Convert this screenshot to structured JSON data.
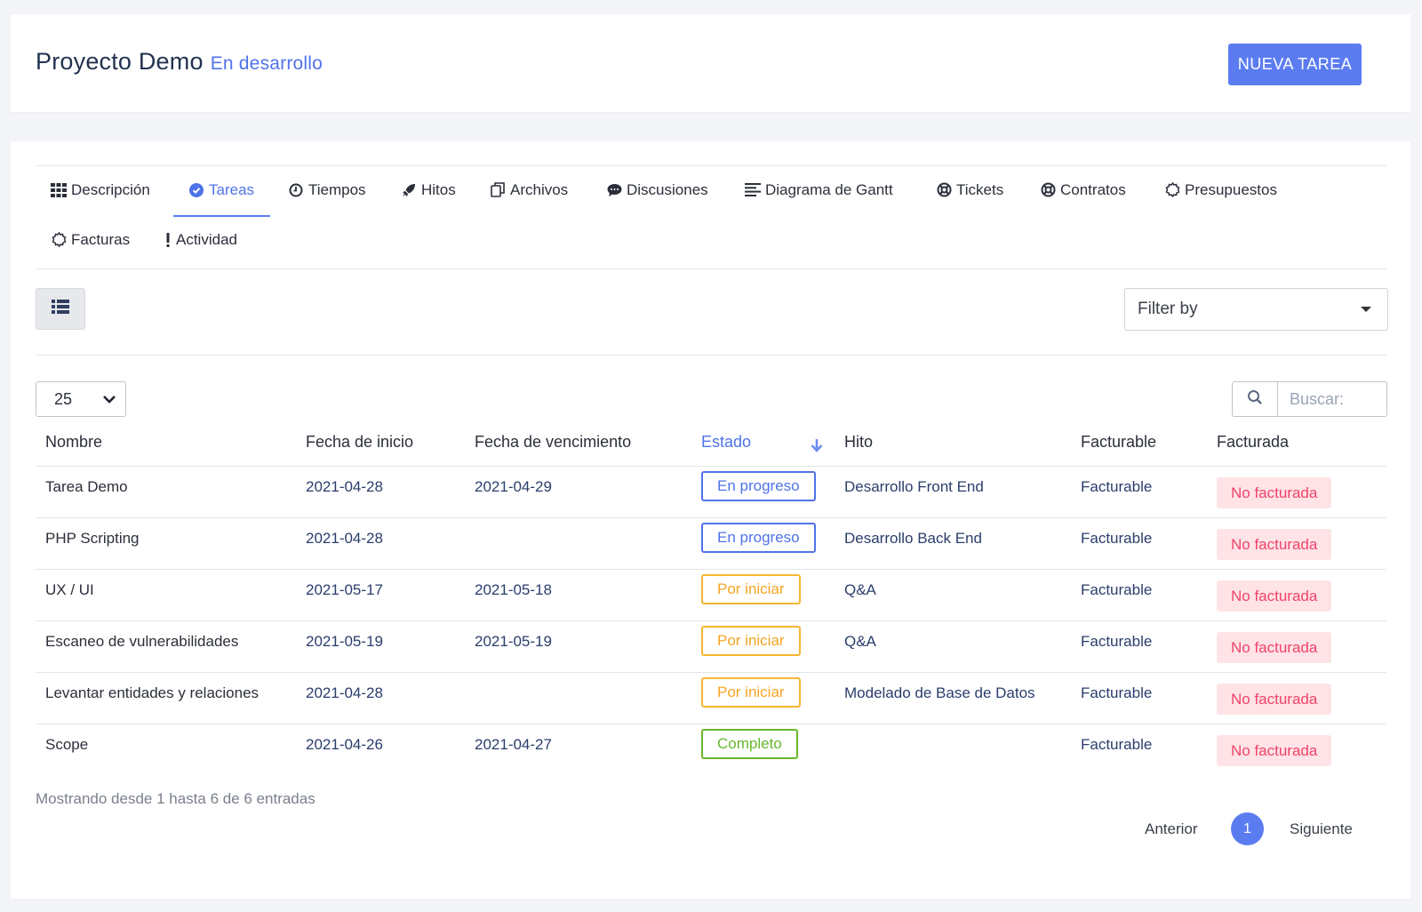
{
  "header": {
    "title": "Proyecto Demo",
    "status": "En desarrollo",
    "new_task_label": "NUEVA TAREA"
  },
  "tabs": [
    {
      "label": "Descripción",
      "icon": "grid-icon",
      "active": false
    },
    {
      "label": "Tareas",
      "icon": "check-circle-icon",
      "active": true
    },
    {
      "label": "Tiempos",
      "icon": "clock-icon",
      "active": false
    },
    {
      "label": "Hitos",
      "icon": "rocket-icon",
      "active": false
    },
    {
      "label": "Archivos",
      "icon": "files-icon",
      "active": false
    },
    {
      "label": "Discusiones",
      "icon": "comment-icon",
      "active": false
    },
    {
      "label": "Diagrama de Gantt",
      "icon": "align-left-icon",
      "active": false
    },
    {
      "label": "Tickets",
      "icon": "life-ring-icon",
      "active": false
    },
    {
      "label": "Contratos",
      "icon": "life-ring-icon",
      "active": false
    },
    {
      "label": "Presupuestos",
      "icon": "gear-outline-icon",
      "active": false
    },
    {
      "label": "Facturas",
      "icon": "gear-outline-icon",
      "active": false
    },
    {
      "label": "Actividad",
      "icon": "exclamation-icon",
      "active": false
    }
  ],
  "toolbar": {
    "filter_label": "Filter by",
    "page_length": "25",
    "search_placeholder": "Buscar:"
  },
  "table": {
    "columns": [
      "Nombre",
      "Fecha de inicio",
      "Fecha de vencimiento",
      "Estado",
      "Hito",
      "Facturable",
      "Facturada"
    ],
    "sorted_column": "Estado",
    "rows": [
      {
        "name": "Tarea Demo",
        "start": "2021-04-28",
        "due": "2021-04-29",
        "status": "En progreso",
        "status_kind": "prog",
        "milestone": "Desarrollo Front End",
        "billable": "Facturable",
        "billed": "No facturada"
      },
      {
        "name": "PHP Scripting",
        "start": "2021-04-28",
        "due": "",
        "status": "En progreso",
        "status_kind": "prog",
        "milestone": "Desarrollo Back End",
        "billable": "Facturable",
        "billed": "No facturada"
      },
      {
        "name": "UX / UI",
        "start": "2021-05-17",
        "due": "2021-05-18",
        "status": "Por iniciar",
        "status_kind": "todo",
        "milestone": "Q&A",
        "billable": "Facturable",
        "billed": "No facturada"
      },
      {
        "name": "Escaneo de vulnerabilidades",
        "start": "2021-05-19",
        "due": "2021-05-19",
        "status": "Por iniciar",
        "status_kind": "todo",
        "milestone": "Q&A",
        "billable": "Facturable",
        "billed": "No facturada"
      },
      {
        "name": "Levantar entidades y relaciones",
        "start": "2021-04-28",
        "due": "",
        "status": "Por iniciar",
        "status_kind": "todo",
        "milestone": "Modelado de Base de Datos",
        "billable": "Facturable",
        "billed": "No facturada"
      },
      {
        "name": "Scope",
        "start": "2021-04-26",
        "due": "2021-04-27",
        "status": "Completo",
        "status_kind": "done",
        "milestone": "",
        "billable": "Facturable",
        "billed": "No facturada"
      }
    ]
  },
  "footer": {
    "info": "Mostrando desde 1 hasta 6 de 6 entradas",
    "prev_label": "Anterior",
    "current_page": "1",
    "next_label": "Siguiente"
  },
  "colors": {
    "accent": "#5b7cf0",
    "in_progress": "#4f73e8",
    "to_start": "#f5a623",
    "complete": "#66b82c",
    "not_billed_bg": "#ffe3e6",
    "not_billed_text": "#f0436a"
  }
}
